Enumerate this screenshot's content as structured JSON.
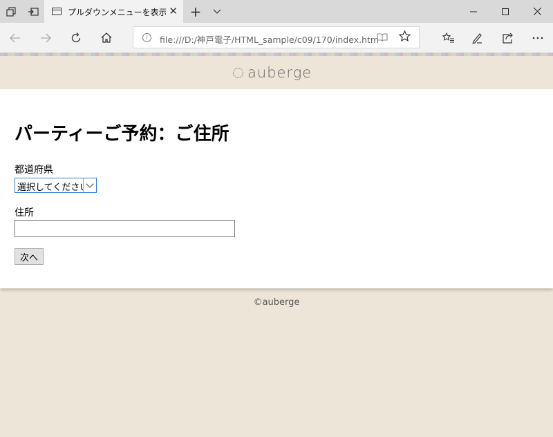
{
  "browser": {
    "tab_title": "プルダウンメニューを表示した",
    "url": "file:///D:/神戸電子/HTML_sample/c09/170/index.htm"
  },
  "icons": {
    "tab_manager": "tab-manager-icon",
    "set_aside": "set-aside-tabs-icon",
    "page": "page-icon",
    "back": "back-arrow-icon",
    "forward": "forward-arrow-icon",
    "refresh": "refresh-icon",
    "home": "home-icon",
    "reading_view": "reading-view-icon",
    "favorite": "star-icon",
    "hub": "hub-icon",
    "notes": "pen-icon",
    "share": "share-icon",
    "more": "more-icon"
  },
  "site": {
    "logo_text": "auberge"
  },
  "form": {
    "title": "パーティーご予約：ご住所",
    "prefecture_label": "都道府県",
    "prefecture_selected": "選択してください",
    "address_label": "住所",
    "address_value": "",
    "submit_label": "次へ"
  },
  "footer": {
    "copyright": "©auberge"
  },
  "colors": {
    "page_background": "#ede6d8",
    "select_focus_border": "#2f7fd1"
  }
}
